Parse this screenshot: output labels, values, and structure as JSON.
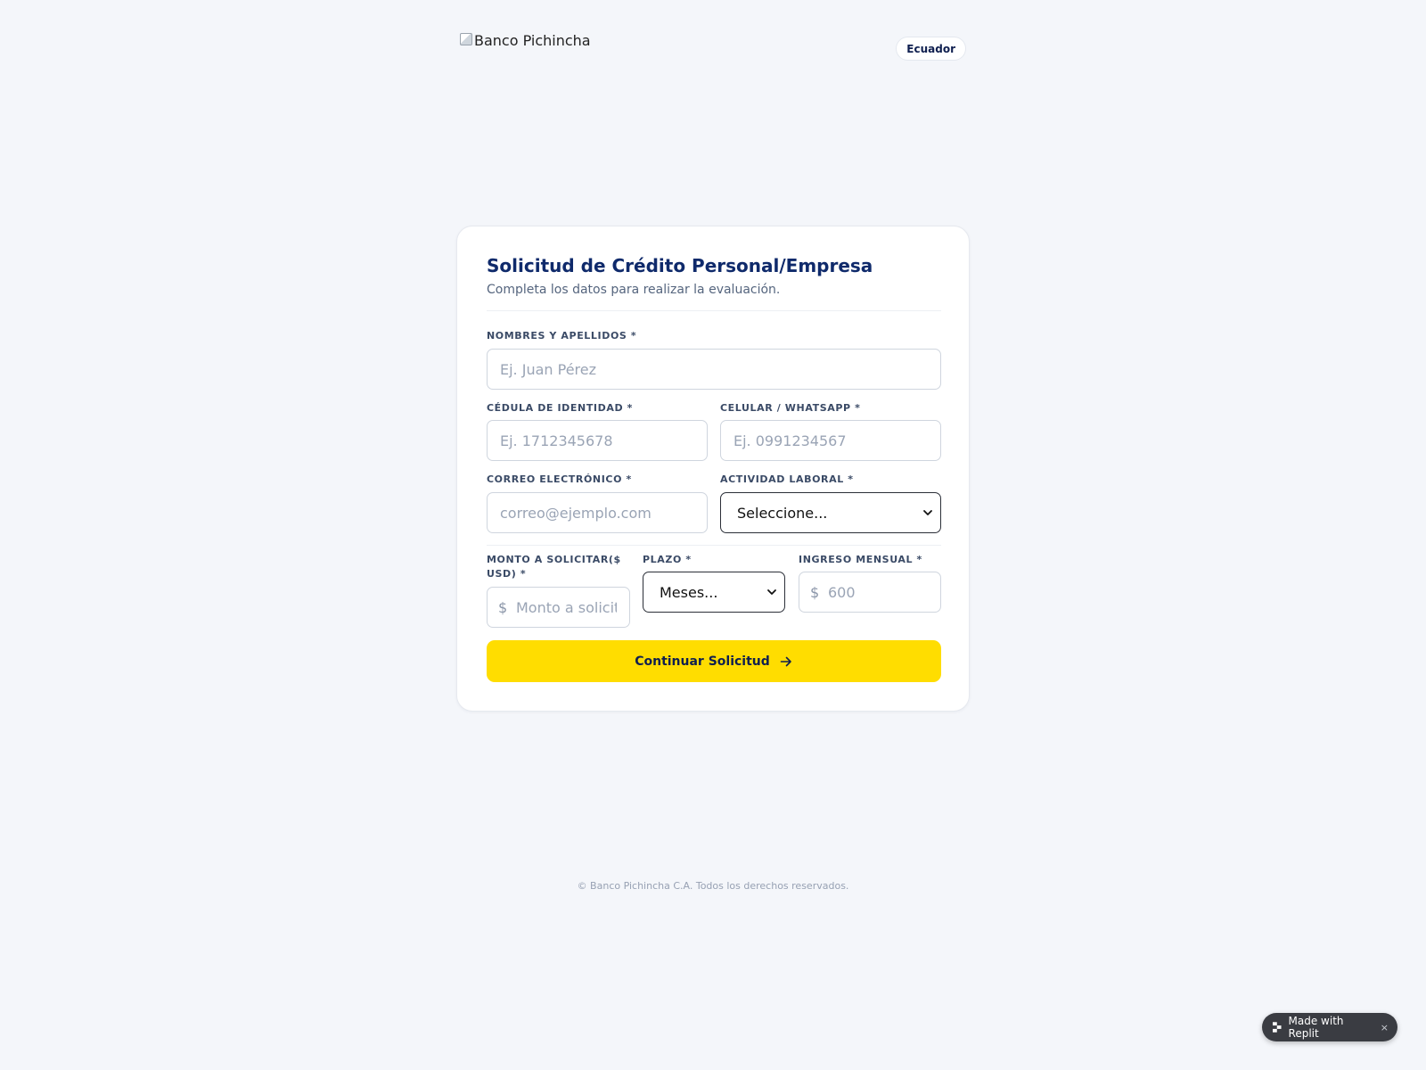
{
  "header": {
    "logo_alt": "Banco Pichincha",
    "country": "Ecuador"
  },
  "form": {
    "title": "Solicitud de Crédito Personal/Empresa",
    "subtitle": "Completa los datos para realizar la evaluación.",
    "fields": {
      "nombres": {
        "label": "NOMBRES Y APELLIDOS *",
        "placeholder": "Ej. Juan Pérez",
        "value": ""
      },
      "cedula": {
        "label": "CÉDULA DE IDENTIDAD *",
        "placeholder": "Ej. 1712345678",
        "value": ""
      },
      "celular": {
        "label": "CELULAR / WHATSAPP *",
        "placeholder": "Ej. 0991234567",
        "value": ""
      },
      "correo": {
        "label": "CORREO ELECTRÓNICO *",
        "placeholder": "correo@ejemplo.com",
        "value": ""
      },
      "actividad": {
        "label": "ACTIVIDAD LABORAL *",
        "selected": "Seleccione..."
      },
      "monto": {
        "label_line1": "MONTO A SOLICITAR($",
        "label_line2": "USD) *",
        "prefix": "$",
        "placeholder": "Monto a solicitar",
        "value": ""
      },
      "plazo": {
        "label": "PLAZO *",
        "selected": "Meses..."
      },
      "ingreso": {
        "label": "INGRESO MENSUAL *",
        "prefix": "$",
        "placeholder": "600",
        "value": ""
      }
    },
    "submit_label": "Continuar Solicitud"
  },
  "footer": {
    "copyright": "© Banco Pichincha C.A. Todos los derechos reservados."
  },
  "badge": {
    "label": "Made with Replit",
    "close": "×"
  },
  "colors": {
    "background": "#f4f6fa",
    "brand_navy": "#0f2a6b",
    "accent_yellow": "#ffdd00"
  }
}
